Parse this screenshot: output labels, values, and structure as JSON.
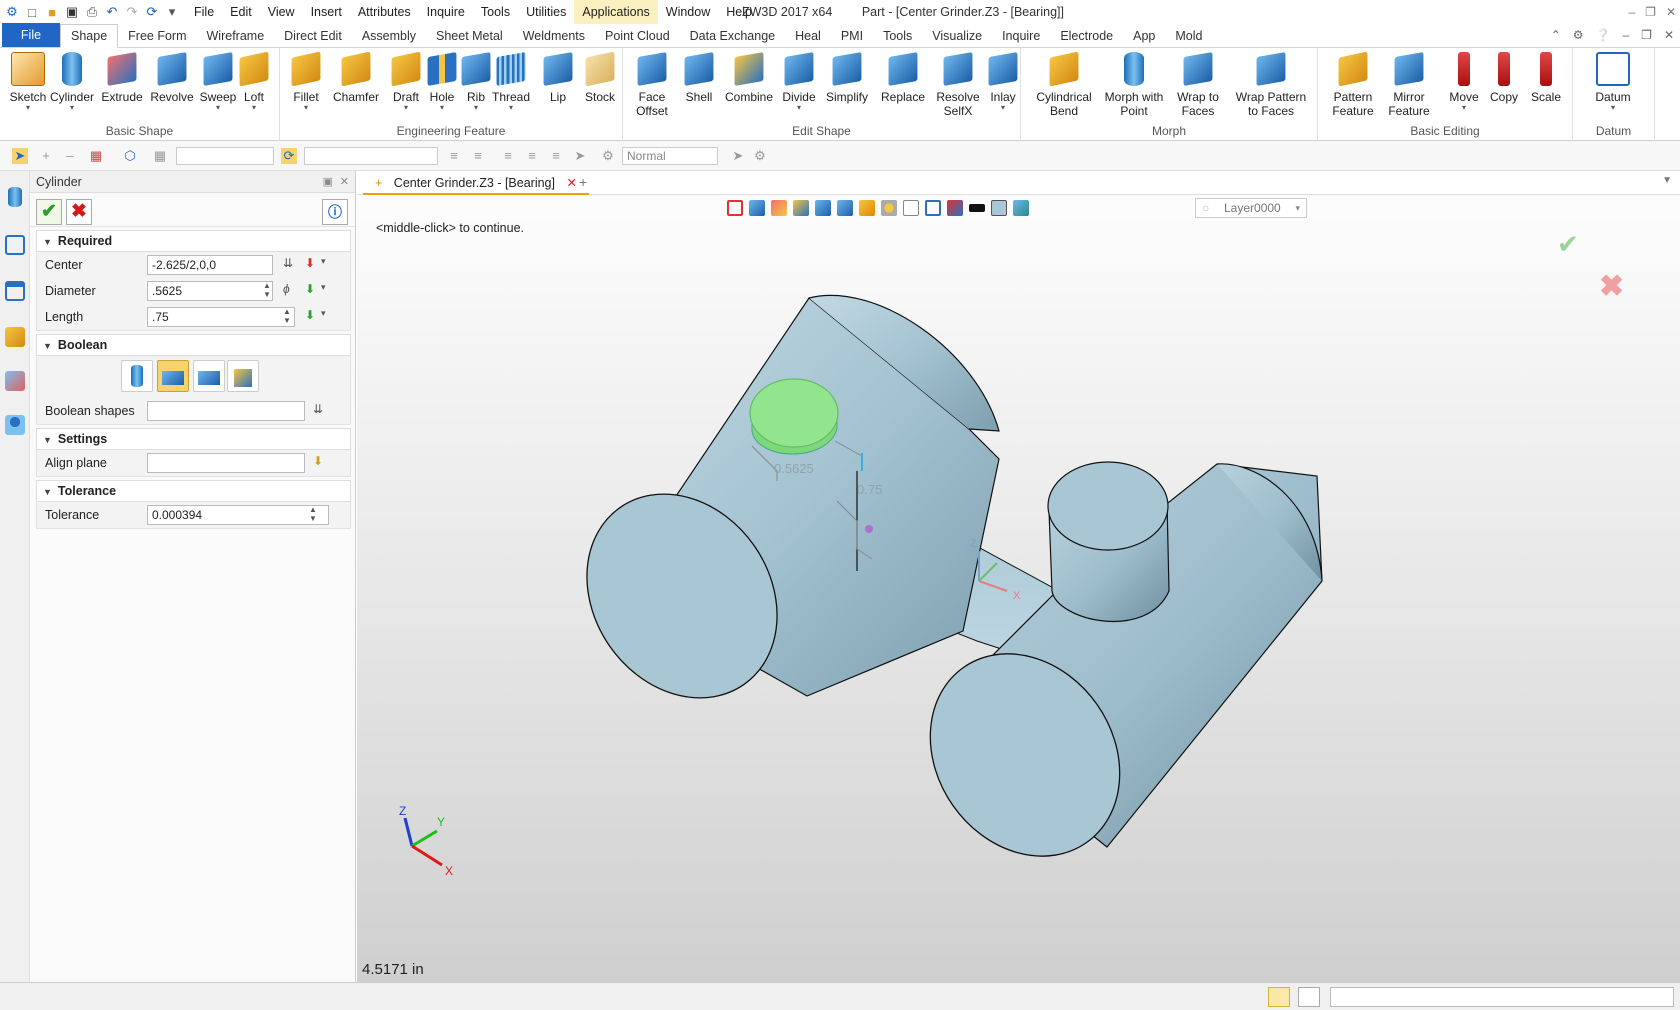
{
  "app": {
    "menu": [
      "File",
      "Edit",
      "View",
      "Insert",
      "Attributes",
      "Inquire",
      "Tools",
      "Utilities",
      "Applications",
      "Window",
      "Help"
    ],
    "title_product": "ZW3D 2017  x64",
    "title_doc": "Part - [Center Grinder.Z3 - [Bearing]]"
  },
  "tabs": [
    "File",
    "Shape",
    "Free Form",
    "Wireframe",
    "Direct Edit",
    "Assembly",
    "Sheet Metal",
    "Weldments",
    "Point Cloud",
    "Data Exchange",
    "Heal",
    "PMI",
    "Tools",
    "Visualize",
    "Inquire",
    "Electrode",
    "App",
    "Mold"
  ],
  "ribbon": {
    "basic_shape": {
      "name": "Basic Shape",
      "buttons": [
        "Sketch",
        "Cylinder",
        "Extrude",
        "Revolve",
        "Sweep",
        "Loft"
      ]
    },
    "engineering": {
      "name": "Engineering Feature",
      "buttons": [
        "Fillet",
        "Chamfer",
        "Draft",
        "Hole",
        "Rib",
        "Thread",
        "Lip",
        "Stock"
      ]
    },
    "edit_shape": {
      "name": "Edit Shape",
      "buttons": [
        "Face Offset",
        "Shell",
        "Combine",
        "Divide",
        "Simplify",
        "Replace",
        "Resolve SelfX",
        "Inlay"
      ]
    },
    "morph": {
      "name": "Morph",
      "buttons": [
        "Cylindrical Bend",
        "Morph with Point",
        "Wrap to Faces",
        "Wrap Pattern to Faces"
      ]
    },
    "basic_editing": {
      "name": "Basic Editing",
      "buttons": [
        "Pattern Feature",
        "Mirror Feature",
        "Move",
        "Copy",
        "Scale"
      ]
    },
    "datum": {
      "name": "Datum",
      "buttons": [
        "Datum"
      ]
    }
  },
  "toolbar2": {
    "render_mode": "Normal"
  },
  "panel": {
    "title": "Cylinder",
    "sections": {
      "required": "Required",
      "boolean": "Boolean",
      "settings": "Settings",
      "tolerance": "Tolerance"
    },
    "fields": {
      "center_label": "Center",
      "center_value": "-2.625/2,0,0",
      "diameter_label": "Diameter",
      "diameter_value": ".5625",
      "length_label": "Length",
      "length_value": ".75",
      "boolean_shapes_label": "Boolean shapes",
      "align_plane_label": "Align plane",
      "tolerance_label": "Tolerance",
      "tolerance_value": "0.000394"
    }
  },
  "viewport": {
    "doc_tab": "Center Grinder.Z3 - [Bearing]",
    "layer": "Layer0000",
    "prompt": "<middle-click> to continue.",
    "dim_diameter": "0.5625",
    "dim_length": "0.75",
    "measurement": "4.5171 in",
    "axis_labels": {
      "x": "X",
      "y": "Y",
      "z": "Z"
    }
  },
  "colors": {
    "accent": "#1f66c7",
    "model": "#a9c7d6",
    "preview": "#90e28c"
  }
}
